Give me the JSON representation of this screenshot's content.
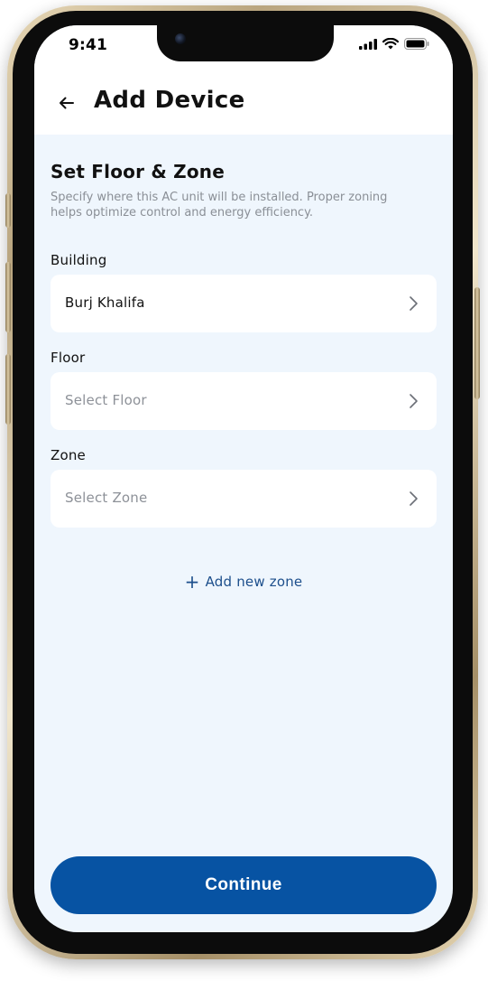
{
  "status_bar": {
    "time": "9:41"
  },
  "header": {
    "title": "Add Device",
    "back_icon": "arrow-left-icon"
  },
  "section": {
    "title": "Set Floor & Zone",
    "description": "Specify where this AC unit will be installed. Proper zoning helps optimize control and energy efficiency."
  },
  "fields": {
    "building": {
      "label": "Building",
      "value": "Burj Khalifa",
      "icon": "chevron-right-icon"
    },
    "floor": {
      "label": "Floor",
      "placeholder": "Select Floor",
      "icon": "chevron-right-icon"
    },
    "zone": {
      "label": "Zone",
      "placeholder": "Select Zone",
      "icon": "chevron-right-icon"
    }
  },
  "add_zone": {
    "icon": "plus-icon",
    "label": "Add new zone"
  },
  "continue_button": {
    "label": "Continue"
  },
  "colors": {
    "accent": "#0753a3",
    "link": "#1d4f8c",
    "background": "#eff6fd"
  }
}
